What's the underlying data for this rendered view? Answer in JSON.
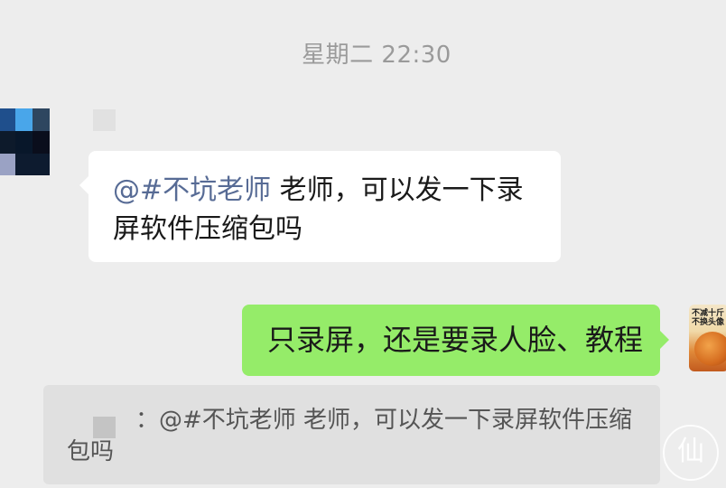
{
  "timestamp": "星期二 22:30",
  "incoming_message": {
    "mention": "@#不坑老师",
    "text": " 老师，可以发一下录屏软件压缩包吗"
  },
  "outgoing_message": {
    "text": "只录屏，还是要录人脸、教程"
  },
  "right_avatar": {
    "line1": "不减十斤",
    "line2": "不换头像"
  },
  "quoted_reply": {
    "text": "：@#不坑老师 老师，可以发一下录屏软件压缩包吗"
  },
  "colors": {
    "background": "#ededed",
    "outgoing_bubble": "#95ec69",
    "incoming_bubble": "#ffffff",
    "mention": "#576b95",
    "quote_background": "#e0e0e0"
  },
  "left_avatar_pixels": [
    "#1f4f8c",
    "#49a6ea",
    "#2e4660",
    "#0d1a2b",
    "#08172a",
    "#0a0e1c",
    "#9aa2c4",
    "#0d1b2f",
    "#0d1b2f"
  ],
  "icons": {
    "watermark": "watermark-seal-icon"
  }
}
